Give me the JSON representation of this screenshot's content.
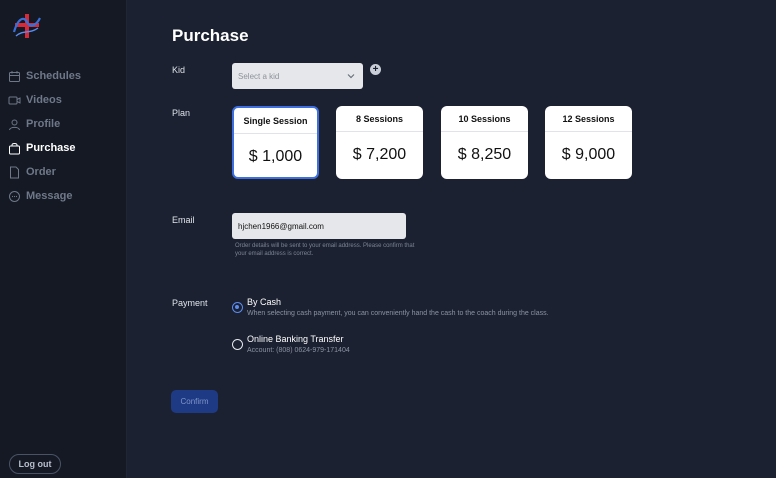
{
  "sidebar": {
    "items": [
      {
        "label": "Schedules",
        "icon": "calendar-icon"
      },
      {
        "label": "Videos",
        "icon": "video-icon"
      },
      {
        "label": "Profile",
        "icon": "user-icon"
      },
      {
        "label": "Purchase",
        "icon": "shopping-bag-icon",
        "active": true
      },
      {
        "label": "Order",
        "icon": "document-icon"
      },
      {
        "label": "Message",
        "icon": "chat-icon"
      }
    ],
    "logout_label": "Log out"
  },
  "page": {
    "title": "Purchase"
  },
  "kid": {
    "label": "Kid",
    "placeholder": "Select a kid"
  },
  "plan": {
    "label": "Plan",
    "options": [
      {
        "name": "Single Session",
        "price": "$ 1,000",
        "selected": true
      },
      {
        "name": "8 Sessions",
        "price": "$ 7,200",
        "selected": false
      },
      {
        "name": "10 Sessions",
        "price": "$ 8,250",
        "selected": false
      },
      {
        "name": "12 Sessions",
        "price": "$ 9,000",
        "selected": false
      }
    ]
  },
  "email": {
    "label": "Email",
    "value": "hjchen1966@gmail.com",
    "note": "Order details will be sent to your email address. Please confirm that your email address is correct."
  },
  "payment": {
    "label": "Payment",
    "options": [
      {
        "title": "By Cash",
        "desc": "When selecting cash payment, you can conveniently hand the cash to the coach during the class.",
        "selected": true
      },
      {
        "title": "Online Banking Transfer",
        "desc": "Account: (808) 0624-979-171404",
        "selected": false
      }
    ]
  },
  "confirm_label": "Confirm",
  "colors": {
    "background": "#1b2130",
    "sidebar": "#141924",
    "accent": "#3d6fe0",
    "confirm_button": "#1e3a84"
  }
}
